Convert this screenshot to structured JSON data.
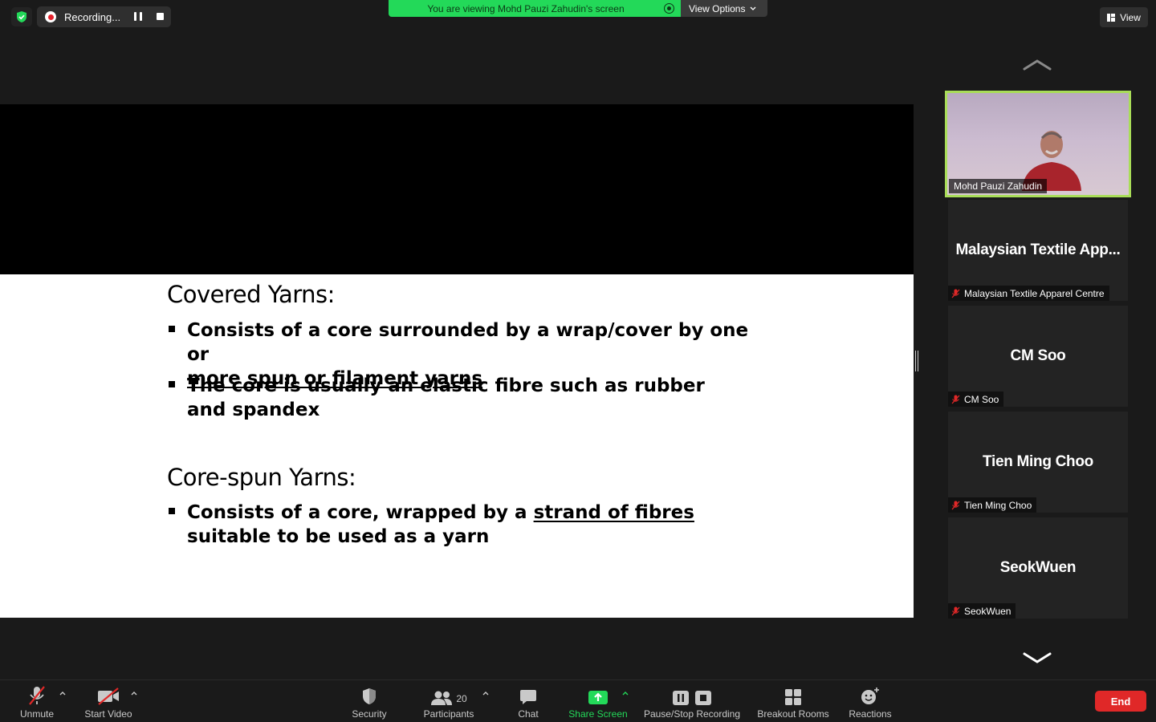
{
  "recording": {
    "label": "Recording...",
    "icon": "record-dot-icon"
  },
  "banner": {
    "text": "You are viewing Mohd Pauzi Zahudin's screen",
    "view_options": "View Options",
    "color": "#23d959"
  },
  "view_button": "View",
  "slide": {
    "heading1": "Covered Yarns:",
    "bullet1_part1": "Consists of a core surrounded by a wrap/cover by one or",
    "bullet1_part2": "more spun or filament yarns",
    "bullet2": "The core is usually an elastic fibre such as rubber and spandex",
    "heading2": "Core-spun Yarns:",
    "bullet3_part1": "Consists of a core, wrapped by a ",
    "bullet3_link": "strand of fibres",
    "bullet3_part2": " suitable to be used as a yarn"
  },
  "gallery": {
    "active_speaker": "Mohd Pauzi Zahudin",
    "active_border_color": "#a9dd58",
    "participants": [
      {
        "title": "Malaysian Textile App...",
        "tag": "Malaysian Textile Apparel Centre",
        "muted": true
      },
      {
        "title": "CM Soo",
        "tag": "CM Soo",
        "muted": true
      },
      {
        "title": "Tien Ming Choo",
        "tag": "Tien Ming Choo",
        "muted": true
      },
      {
        "title": "SeokWuen",
        "tag": "SeokWuen",
        "muted": true
      }
    ]
  },
  "toolbar": {
    "unmute": "Unmute",
    "start_video": "Start Video",
    "security": "Security",
    "participants": "Participants",
    "participants_count": "20",
    "chat": "Chat",
    "share_screen": "Share Screen",
    "pause_stop_recording": "Pause/Stop Recording",
    "breakout_rooms": "Breakout Rooms",
    "reactions": "Reactions",
    "end": "End",
    "end_color": "#e02828"
  }
}
